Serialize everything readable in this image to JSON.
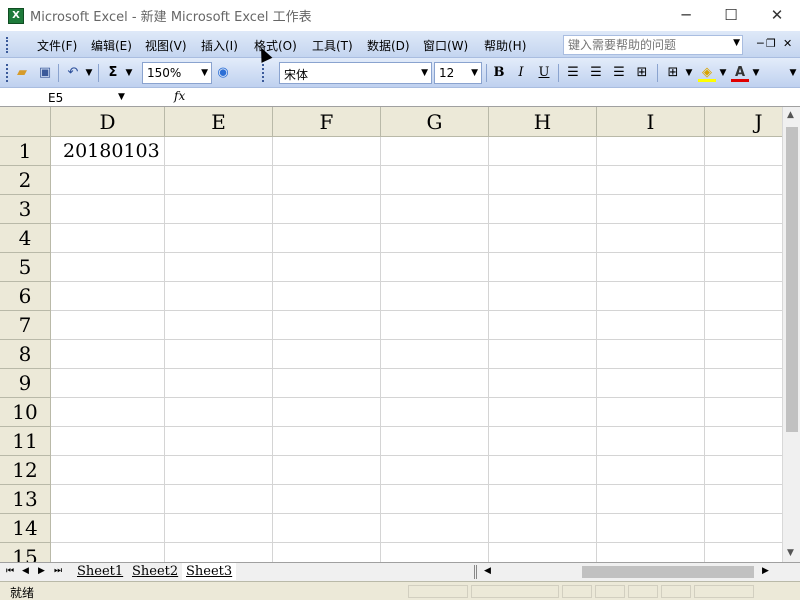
{
  "window": {
    "title": "Microsoft Excel - 新建 Microsoft Excel 工作表",
    "minimize_glyph": "─",
    "maximize_glyph": "☐",
    "close_glyph": "✕"
  },
  "menubar": {
    "items": [
      "文件(F)",
      "编辑(E)",
      "视图(V)",
      "插入(I)",
      "格式(O)",
      "工具(T)",
      "数据(D)",
      "窗口(W)",
      "帮助(H)"
    ],
    "help_placeholder": "键入需要帮助的问题"
  },
  "toolbar": {
    "zoom": "150%",
    "font_name": "宋体",
    "font_size": "12",
    "bold_label": "B",
    "italic_label": "I",
    "underline_label": "U",
    "sum_label": "Σ"
  },
  "formula_bar": {
    "name_box": "E5",
    "fx_label": "fx",
    "formula": ""
  },
  "grid": {
    "columns": [
      "D",
      "E",
      "F",
      "G",
      "H",
      "I",
      "J"
    ],
    "rows": [
      "1",
      "2",
      "3",
      "4",
      "5",
      "6",
      "7",
      "8",
      "9",
      "10",
      "11",
      "12",
      "13",
      "14",
      "15"
    ],
    "cells": {
      "D1": "20180103"
    }
  },
  "sheets": {
    "tabs": [
      "Sheet1",
      "Sheet2",
      "Sheet3"
    ],
    "active": "Sheet3"
  },
  "status": {
    "text": "就绪"
  }
}
